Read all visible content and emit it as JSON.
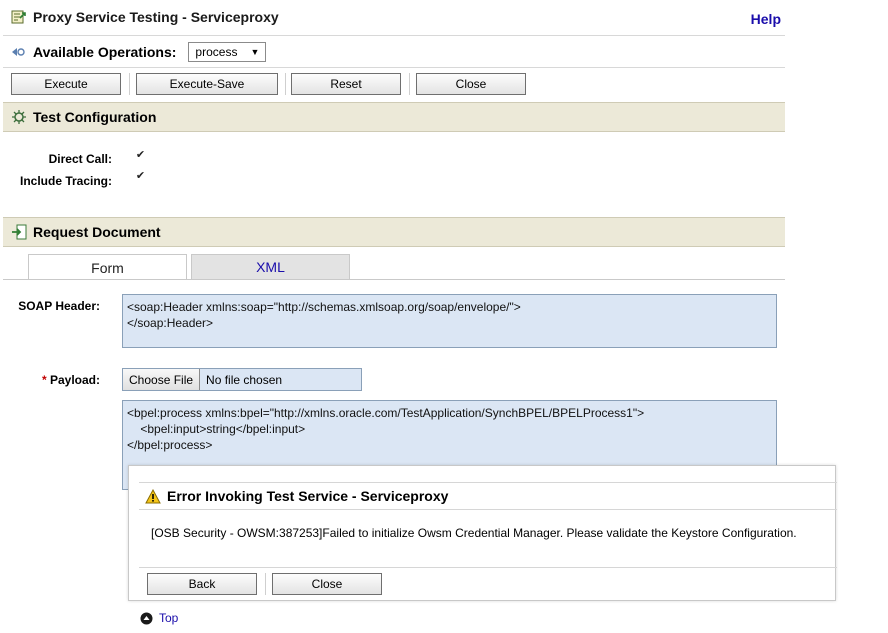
{
  "header": {
    "title": "Proxy Service Testing - Serviceproxy",
    "help": "Help"
  },
  "operations": {
    "label": "Available Operations:",
    "selected": "process"
  },
  "toolbar": {
    "execute": "Execute",
    "execute_save": "Execute-Save",
    "reset": "Reset",
    "close": "Close"
  },
  "test_config": {
    "title": "Test Configuration",
    "direct_call_label": "Direct Call:",
    "direct_call_checked": true,
    "include_tracing_label": "Include Tracing:",
    "include_tracing_checked": true
  },
  "request": {
    "title": "Request Document",
    "tabs": [
      {
        "label": "Form",
        "active": true
      },
      {
        "label": "XML",
        "active": false
      }
    ],
    "soap_header_label": "SOAP Header:",
    "soap_header_value": "<soap:Header xmlns:soap=\"http://schemas.xmlsoap.org/soap/envelope/\">\n</soap:Header>",
    "payload_required_mark": "*",
    "payload_label": "Payload:",
    "choose_file": "Choose File",
    "no_file": "No file chosen",
    "payload_value": "<bpel:process xmlns:bpel=\"http://xmlns.oracle.com/TestApplication/SynchBPEL/BPELProcess1\">\n    <bpel:input>string</bpel:input>\n</bpel:process>"
  },
  "dialog": {
    "title": "Error Invoking Test Service - Serviceproxy",
    "message": "[OSB Security - OWSM:387253]Failed to initialize Owsm Credential Manager. Please validate the Keystore Configuration.",
    "back": "Back",
    "close": "Close"
  },
  "top_link": "Top",
  "colors": {
    "section_bg": "#ece9d8",
    "field_bg": "#dbe6f4",
    "link": "#1a0dab",
    "required": "#c00000"
  }
}
